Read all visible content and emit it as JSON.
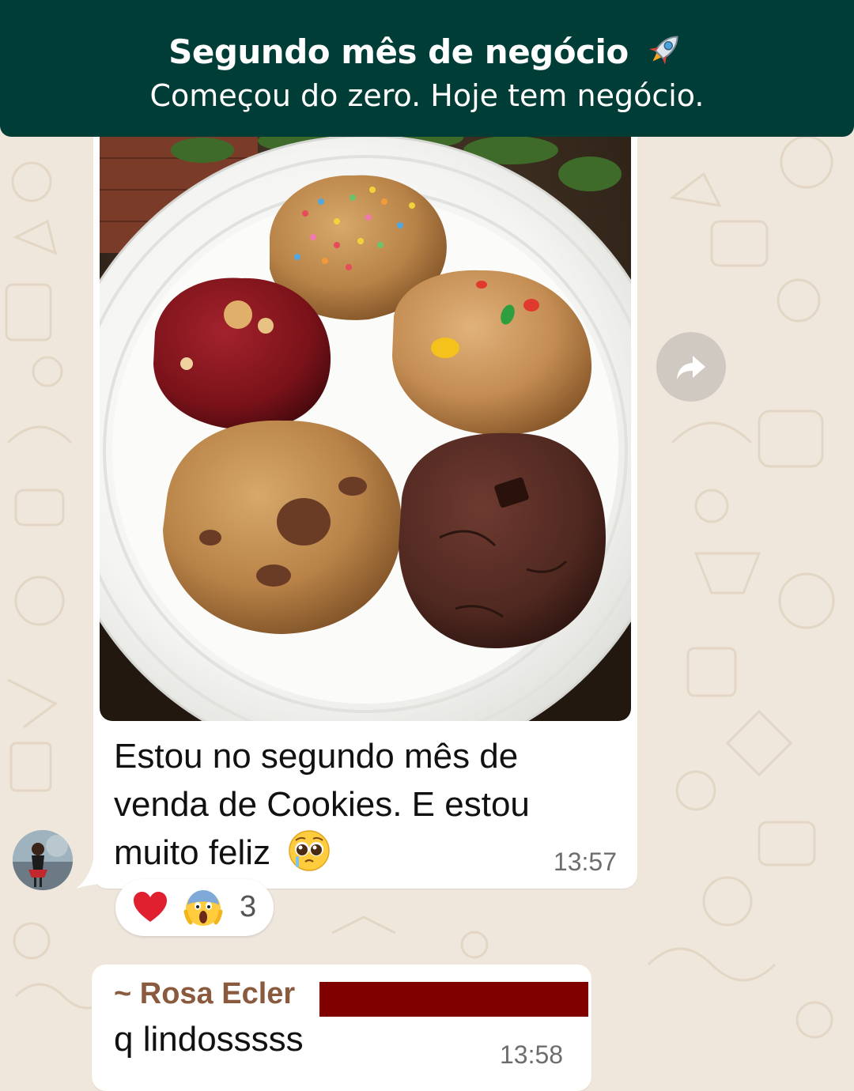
{
  "banner": {
    "title": "Segundo mês de negócio",
    "subtitle": "Começou do zero. Hoje tem negócio."
  },
  "message1": {
    "text": "Estou no segundo mês de venda de Cookies. E estou muito feliz",
    "emoji": "pleading-face-emoji",
    "time": "13:57",
    "reactions": {
      "emojis": [
        "heart",
        "face-screaming"
      ],
      "count": "3"
    }
  },
  "message2": {
    "sender": "~ Rosa Ecler",
    "text": "q lindosssss",
    "time": "13:58"
  },
  "colors": {
    "banner": "#013d37",
    "wallpaper": "#efe7dc",
    "sender": "#8a5a3e",
    "redaction": "#800000"
  }
}
